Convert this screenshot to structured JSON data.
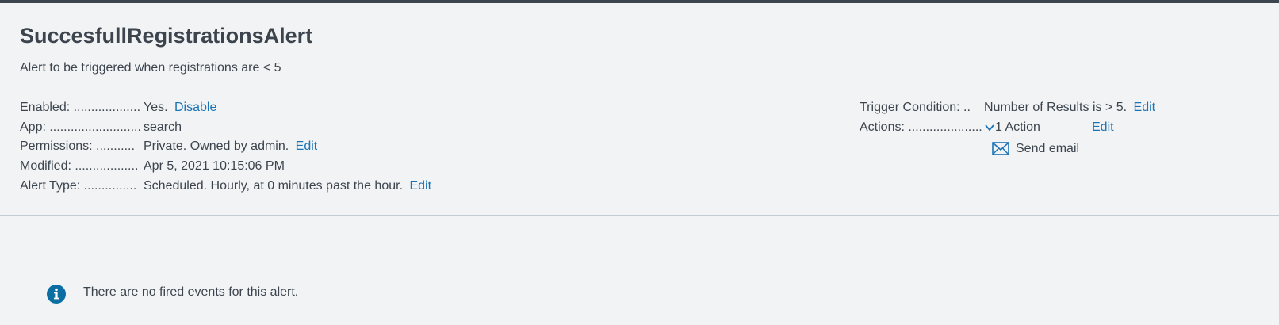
{
  "alert": {
    "title": "SuccesfullRegistrationsAlert",
    "description": "Alert to be triggered when registrations are < 5"
  },
  "details": {
    "enabled": {
      "label": "Enabled: ...................",
      "value": "Yes.",
      "action": "Disable"
    },
    "app": {
      "label": "App: ..........................",
      "value": "search"
    },
    "permissions": {
      "label": "Permissions: ...........",
      "value": "Private. Owned by admin.",
      "action": "Edit"
    },
    "modified": {
      "label": "Modified: ..................",
      "value": "Apr 5, 2021 10:15:06 PM"
    },
    "alert_type": {
      "label": "Alert Type: ...............",
      "value": "Scheduled. Hourly, at 0 minutes past the hour.",
      "action": "Edit"
    }
  },
  "trigger": {
    "condition": {
      "label": "Trigger Condition: ..",
      "value": "Number of Results is > 5.",
      "action": "Edit"
    },
    "actions": {
      "label": "Actions: .....................",
      "value": "1 Action",
      "action": "Edit"
    },
    "action_items": [
      {
        "label": "Send email",
        "icon": "envelope-icon"
      }
    ]
  },
  "events": {
    "empty_message": "There are no fired events for this alert.",
    "icon": "info-icon"
  },
  "colors": {
    "accent": "#1a73b5",
    "info_icon": "#0b6fa3",
    "topbar": "#3c444d",
    "background": "#f2f3f5"
  }
}
